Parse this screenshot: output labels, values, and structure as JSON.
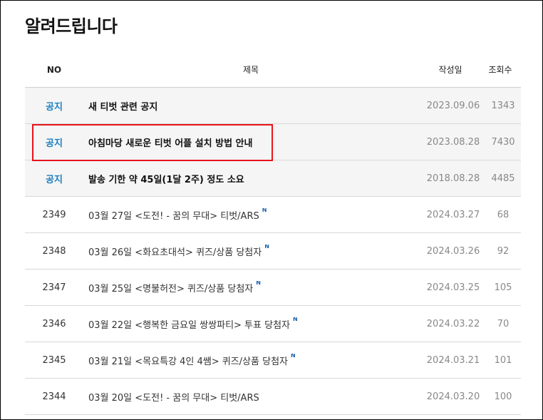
{
  "page": {
    "title": "알려드립니다"
  },
  "table": {
    "headers": {
      "no": "NO",
      "title": "제목",
      "date": "작성일",
      "views": "조회수"
    },
    "rows": [
      {
        "no": "공지",
        "title": "새 티벗 관련 공지",
        "date": "2023.09.06",
        "views": "1343",
        "notice": true
      },
      {
        "no": "공지",
        "title": "아침마당 새로운 티벗 어플 설치 방법 안내",
        "date": "2023.08.28",
        "views": "7430",
        "notice": true
      },
      {
        "no": "공지",
        "title": "발송 기한 약 45일(1달 2주) 정도 소요",
        "date": "2018.08.28",
        "views": "4485",
        "notice": true
      },
      {
        "no": "2349",
        "title": "03월 27일 <도전! - 꿈의 무대> 티벗/ARS",
        "badge": "N",
        "date": "2024.03.27",
        "views": "68"
      },
      {
        "no": "2348",
        "title": "03월 26일 <화요초대석> 퀴즈/상품 당첨자",
        "badge": "N",
        "date": "2024.03.26",
        "views": "92"
      },
      {
        "no": "2347",
        "title": "03월 25일 <명불허전> 퀴즈/상품 당첨자",
        "badge": "N",
        "date": "2024.03.25",
        "views": "105"
      },
      {
        "no": "2346",
        "title": "03월 22일 <행복한 금요일 쌍쌍파티> 투표 당첨자",
        "badge": "N",
        "date": "2024.03.22",
        "views": "70"
      },
      {
        "no": "2345",
        "title": "03월 21일 <목요특강 4인 4쌤> 퀴즈/상품 당첨자",
        "badge": "N",
        "date": "2024.03.21",
        "views": "101"
      },
      {
        "no": "2344",
        "title": "03월 20일 <도전! - 꿈의 무대> 티벗/ARS",
        "date": "2024.03.20",
        "views": "100"
      }
    ]
  },
  "colors": {
    "notice_label": "#1a7fc0",
    "highlight_border": "#e8141b",
    "new_badge": "#1d5fa8"
  }
}
